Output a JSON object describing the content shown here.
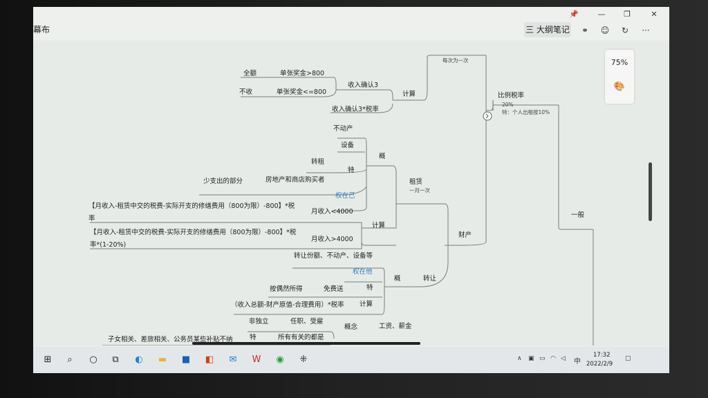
{
  "window": {
    "title": "幕布"
  },
  "header": {
    "outline_label": "三 大纲笔记",
    "more": "···"
  },
  "zoom": {
    "label": "75%"
  },
  "mindmap": {
    "n_cishu": "每次为一次",
    "n_quane": "全额",
    "n_danzhang800": "单张奖金>800",
    "n_shouru_queren3": "收入确认3",
    "n_buhsou": "不收",
    "n_danzhang_le800": "单张奖金<=800",
    "n_jisuan1": "计算",
    "n_shouru_3_shuilv": "收入确认3*税率",
    "n_bili_shuilv": "比例税率",
    "n_20pct": "20%",
    "n_te_geren": "特：个人出租按10%",
    "n_budongchan": "不动产",
    "n_shebei": "设备",
    "n_gai1": "概",
    "n_zhuanzu": "转租",
    "n_te1": "特",
    "n_shaozhichu": "少支出的部分",
    "n_fangdichan": "房地产和商店购买者",
    "n_zulin": "租赁",
    "n_yiyue": "一月一次",
    "n_quanzaiji": "权在己",
    "n_formula1": "【月收入-租赁中交的税费-实际开支的修缮费用（800为限）-800】*税",
    "n_formula1b": "率",
    "n_yue4000a": "月收入<4000",
    "n_jisuan2": "计算",
    "n_formula2": "【月收入-租赁中交的税费-实际开支的修缮费用（800为限）-800】*税",
    "n_formula2b": "率*(1-20%)",
    "n_yue4000b": "月收入>4000",
    "n_caichan": "财产",
    "n_yiban": "一般",
    "n_zhuanrang_fene": "转让份额、不动产、设备等",
    "n_quanzaita": "权在他",
    "n_gai2": "概",
    "n_zhuanrang": "转让",
    "n_ouran": "按偶然所得",
    "n_mianfeisong": "免费送",
    "n_te2": "特",
    "n_formula3": "（收入总额-财产原值-合理费用）*税率",
    "n_jisuan3": "计算",
    "n_feiduli": "非独立",
    "n_renzhi": "任职、受雇",
    "n_gainian": "概念",
    "n_gongzi": "工资、薪金",
    "n_zinv": "子女相关、差旅相关、公务员某些补贴不纳",
    "n_te3": "特",
    "n_suoyou": "所有有关的都是"
  },
  "taskbar": {
    "icons": [
      "windows-start-icon",
      "search-icon",
      "cortana-icon",
      "task-view-icon",
      "edge-icon",
      "file-explorer-icon",
      "store-icon",
      "office-icon",
      "mail-icon",
      "wps-icon",
      "chrome-icon",
      "mubu-icon"
    ],
    "ime": "中",
    "time": "17:32",
    "date": "2022/2/9"
  }
}
